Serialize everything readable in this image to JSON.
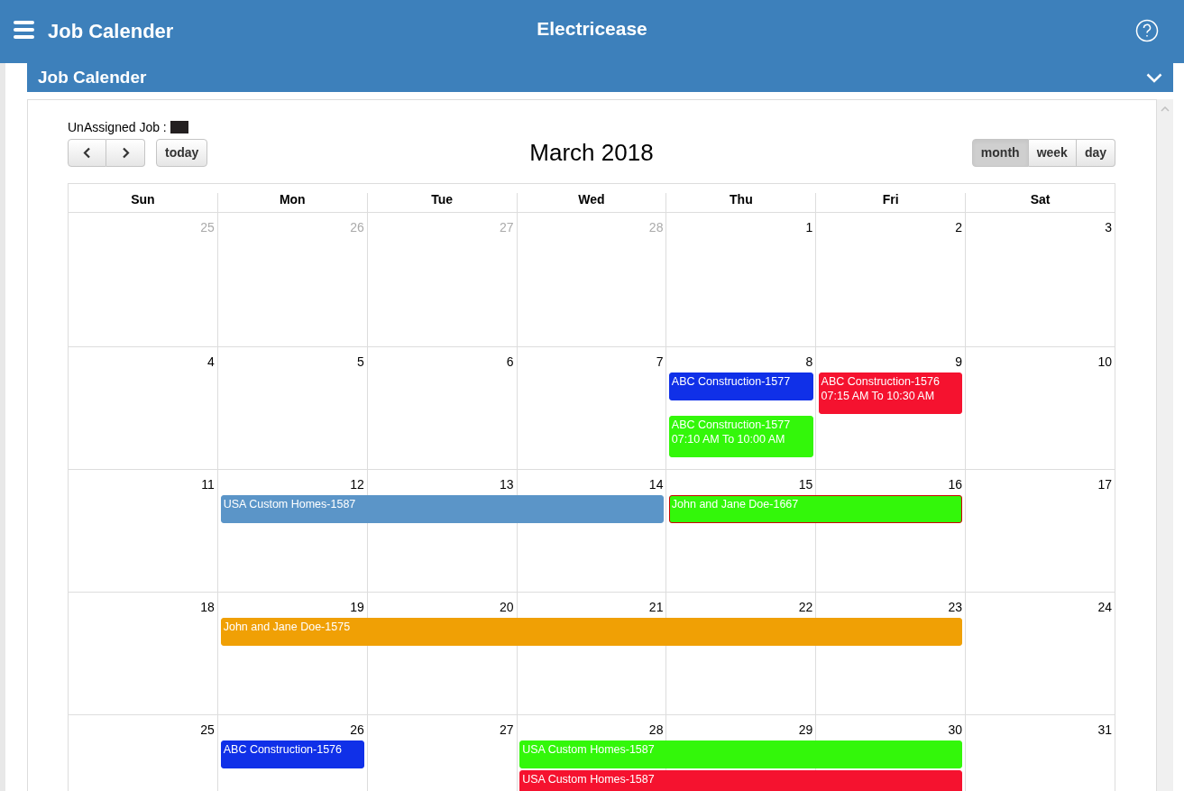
{
  "app_bar": {
    "title": "Job Calender",
    "brand": "Electricease"
  },
  "panel": {
    "title": "Job Calender",
    "expanded": true
  },
  "legend": {
    "label": "UnAssigned Job :",
    "color": "#231f20"
  },
  "toolbar": {
    "today": "today",
    "title": "March 2018",
    "views": [
      {
        "label": "month",
        "selected": true
      },
      {
        "label": "week",
        "selected": false
      },
      {
        "label": "day",
        "selected": false
      }
    ]
  },
  "weekdays": [
    "Sun",
    "Mon",
    "Tue",
    "Wed",
    "Thu",
    "Fri",
    "Sat"
  ],
  "weeks": [
    {
      "days": [
        {
          "number": "25",
          "other_month": true
        },
        {
          "number": "26",
          "other_month": true
        },
        {
          "number": "27",
          "other_month": true
        },
        {
          "number": "28",
          "other_month": true
        },
        {
          "number": "1",
          "other_month": false
        },
        {
          "number": "2",
          "other_month": false
        },
        {
          "number": "3",
          "other_month": false
        }
      ]
    },
    {
      "days": [
        {
          "number": "4",
          "other_month": false
        },
        {
          "number": "5",
          "other_month": false
        },
        {
          "number": "6",
          "other_month": false
        },
        {
          "number": "7",
          "other_month": false
        },
        {
          "number": "8",
          "other_month": false,
          "events": [
            {
              "kind": "event",
              "title": "ABC Construction-1577",
              "color": "#1030e8",
              "outlined": false
            },
            {
              "kind": "event",
              "title": "ABC Construction-1577",
              "time": "07:10 AM To 10:00 AM",
              "color": "#33f70a",
              "outlined": false
            }
          ]
        },
        {
          "number": "9",
          "other_month": false,
          "events": [
            {
              "kind": "event",
              "title": "ABC Construction-1576",
              "time": "07:15 AM To 10:30 AM",
              "color": "#f5122f",
              "outlined": false
            }
          ]
        },
        {
          "number": "10",
          "other_month": false
        }
      ]
    },
    {
      "days": [
        {
          "number": "11",
          "other_month": false
        },
        {
          "number": "12",
          "other_month": false,
          "events": [
            {
              "kind": "event",
              "title": "USA Custom Homes-1587",
              "color": "#5b95c8",
              "outlined": false
            }
          ]
        },
        {
          "number": "13",
          "other_month": false,
          "events": [
            {
              "kind": "continuation"
            }
          ]
        },
        {
          "number": "14",
          "other_month": false,
          "events": [
            {
              "kind": "continuation"
            }
          ]
        },
        {
          "number": "15",
          "other_month": false,
          "events": [
            {
              "kind": "event",
              "title": "John and Jane Doe-1667",
              "color": "#33f70a",
              "outlined": true
            }
          ]
        },
        {
          "number": "16",
          "other_month": false,
          "events": [
            {
              "kind": "continuation"
            }
          ]
        },
        {
          "number": "17",
          "other_month": false
        }
      ]
    },
    {
      "days": [
        {
          "number": "18",
          "other_month": false
        },
        {
          "number": "19",
          "other_month": false,
          "events": [
            {
              "kind": "event",
              "title": "John and Jane Doe-1575",
              "color": "#f0a005",
              "outlined": false
            }
          ]
        },
        {
          "number": "20",
          "other_month": false,
          "events": [
            {
              "kind": "continuation"
            }
          ]
        },
        {
          "number": "21",
          "other_month": false,
          "events": [
            {
              "kind": "continuation"
            }
          ]
        },
        {
          "number": "22",
          "other_month": false,
          "events": [
            {
              "kind": "continuation"
            }
          ]
        },
        {
          "number": "23",
          "other_month": false,
          "events": [
            {
              "kind": "continuation"
            }
          ]
        },
        {
          "number": "24",
          "other_month": false
        }
      ]
    },
    {
      "days": [
        {
          "number": "25",
          "other_month": false
        },
        {
          "number": "26",
          "other_month": false,
          "events": [
            {
              "kind": "event",
              "title": "ABC Construction-1576",
              "color": "#1030e8",
              "outlined": false
            }
          ]
        },
        {
          "number": "27",
          "other_month": false
        },
        {
          "number": "28",
          "other_month": false,
          "events": [
            {
              "kind": "event",
              "title": "USA Custom Homes-1587",
              "color": "#33f70a",
              "outlined": false
            },
            {
              "kind": "event",
              "title": "USA Custom Homes-1587",
              "color": "#f5122f",
              "outlined": false
            }
          ]
        },
        {
          "number": "29",
          "other_month": false,
          "events": [
            {
              "kind": "continuation"
            },
            {
              "kind": "continuation"
            }
          ]
        },
        {
          "number": "30",
          "other_month": false,
          "events": [
            {
              "kind": "continuation"
            },
            {
              "kind": "continuation"
            }
          ]
        },
        {
          "number": "31",
          "other_month": false
        }
      ]
    }
  ]
}
